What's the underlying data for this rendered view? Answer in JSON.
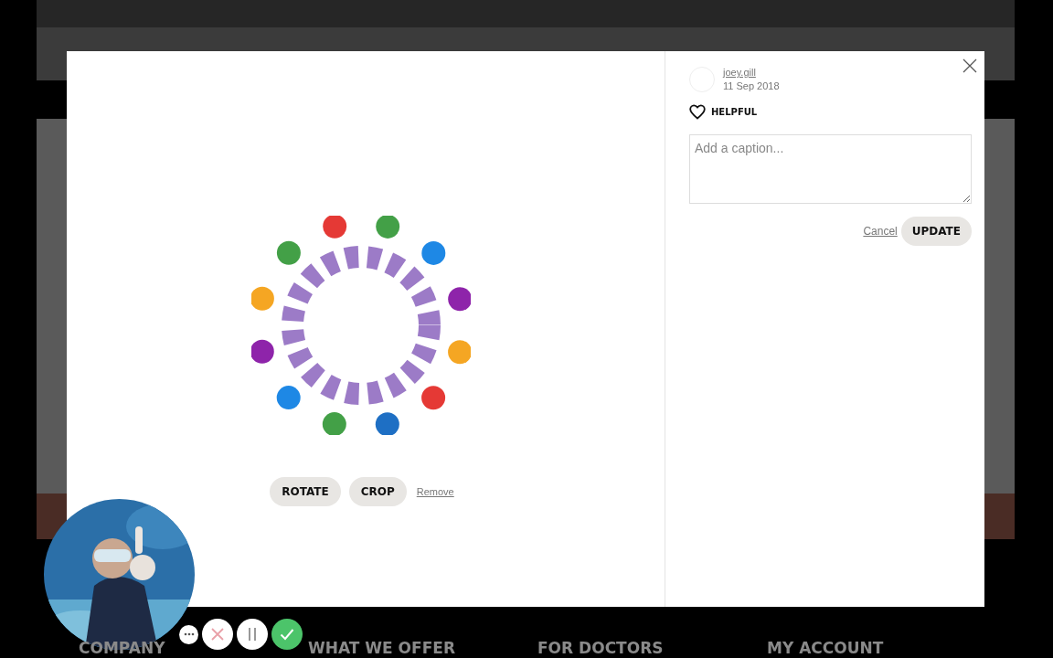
{
  "modal": {
    "image_tools": [
      {
        "label": "ROTATE",
        "kind": "button"
      },
      {
        "label": "CROP",
        "kind": "button"
      },
      {
        "label": "Remove",
        "kind": "link"
      }
    ],
    "author": {
      "name": "joey.gill",
      "date": "11 Sep 2018"
    },
    "helpful": {
      "label": "HELPFUL"
    },
    "caption": {
      "placeholder": "Add a caption..."
    },
    "actions": [
      {
        "label": "Cancel",
        "kind": "link"
      },
      {
        "label": "UPDATE",
        "kind": "button"
      }
    ]
  },
  "footer": {
    "headings": [
      "COMPANY",
      "WHAT WE OFFER",
      "FOR DOCTORS",
      "MY ACCOUNT"
    ]
  }
}
